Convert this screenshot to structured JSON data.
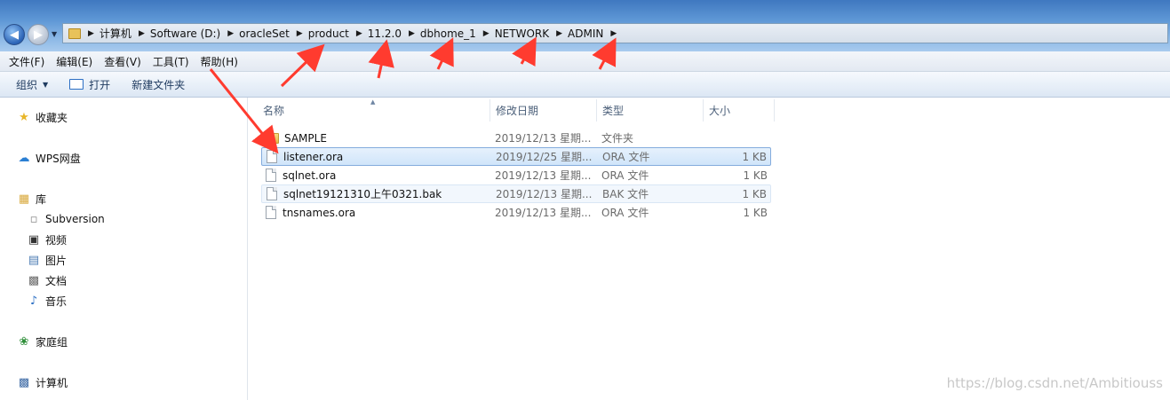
{
  "address_bar": {
    "breadcrumbs": [
      "计算机",
      "Software (D:)",
      "oracleSet",
      "product",
      "11.2.0",
      "dbhome_1",
      "NETWORK",
      "ADMIN"
    ]
  },
  "menu": [
    "文件(F)",
    "编辑(E)",
    "查看(V)",
    "工具(T)",
    "帮助(H)"
  ],
  "toolbar": {
    "organize_label": "组织",
    "open_label": "打开",
    "new_folder_label": "新建文件夹"
  },
  "sidebar": {
    "favorites": "收藏夹",
    "wps": "WPS网盘",
    "libraries": "库",
    "library_items": [
      "Subversion",
      "视频",
      "图片",
      "文档",
      "音乐"
    ],
    "homegroup": "家庭组",
    "computer": "计算机"
  },
  "columns": {
    "name": "名称",
    "date": "修改日期",
    "type": "类型",
    "size": "大小"
  },
  "files": [
    {
      "name": "SAMPLE",
      "date": "2019/12/13 星期...",
      "type": "文件夹",
      "size": ""
    },
    {
      "name": "listener.ora",
      "date": "2019/12/25 星期...",
      "type": "ORA 文件",
      "size": "1 KB"
    },
    {
      "name": "sqlnet.ora",
      "date": "2019/12/13 星期...",
      "type": "ORA 文件",
      "size": "1 KB"
    },
    {
      "name": "sqlnet19121310上午0321.bak",
      "date": "2019/12/13 星期...",
      "type": "BAK 文件",
      "size": "1 KB"
    },
    {
      "name": "tnsnames.ora",
      "date": "2019/12/13 星期...",
      "type": "ORA 文件",
      "size": "1 KB"
    }
  ],
  "watermark": "https://blog.csdn.net/Ambitiouss",
  "colors": {
    "annotation_arrow": "#ff3b2f",
    "selection": "#cfe3f8"
  }
}
